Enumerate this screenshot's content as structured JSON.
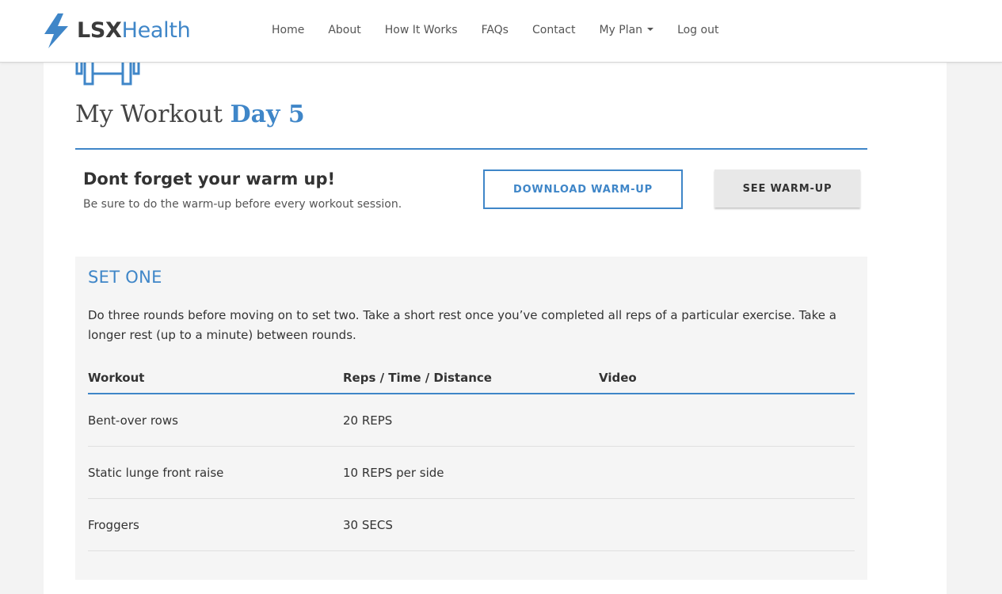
{
  "brand": {
    "bold": "LSX",
    "light": "Health",
    "accent": "#3f86c8"
  },
  "nav": {
    "items": [
      {
        "label": "Home"
      },
      {
        "label": "About"
      },
      {
        "label": "How It Works"
      },
      {
        "label": "FAQs"
      },
      {
        "label": "Contact"
      },
      {
        "label": "My Plan"
      },
      {
        "label": "Log out"
      }
    ]
  },
  "page": {
    "title_prefix": "My Workout",
    "title_day": "Day 5"
  },
  "warmup": {
    "heading": "Dont forget your warm up!",
    "text": "Be sure to do the warm-up before every workout session.",
    "download_label": "DOWNLOAD WARM-UP",
    "see_label": "SEE WARM-UP"
  },
  "set": {
    "title": "SET ONE",
    "description": "Do three rounds before moving on to set two. Take a short rest once you’ve completed all reps of a particular exercise. Take a longer rest (up to a minute) between rounds.",
    "columns": [
      "Workout",
      "Reps / Time / Distance",
      "Video"
    ],
    "rows": [
      {
        "workout": "Bent-over rows",
        "reps": "20 REPS"
      },
      {
        "workout": "Static lunge front raise",
        "reps": "10 REPS per side"
      },
      {
        "workout": "Froggers",
        "reps": "30 SECS"
      }
    ]
  }
}
